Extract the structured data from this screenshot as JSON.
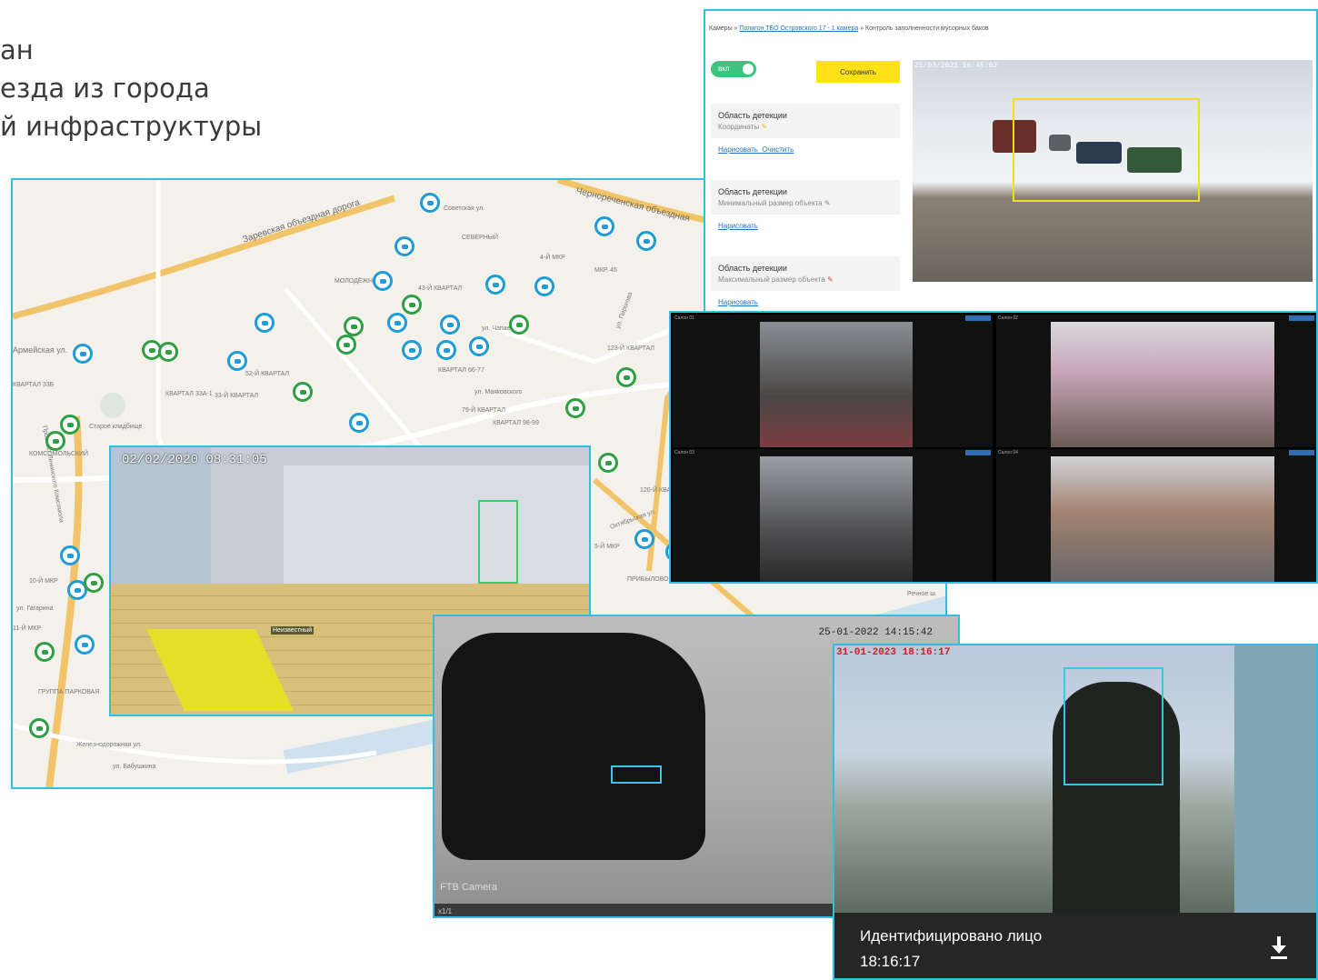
{
  "heading": {
    "line1": "ан",
    "line2": "езда из города",
    "line3": "й инфраструктуры"
  },
  "map": {
    "streets": [
      {
        "text": "Заревская объездная дорога"
      },
      {
        "text": "Черноречeнская объездная"
      },
      {
        "text": "Советская ул."
      },
      {
        "text": "ул. Чапаева"
      },
      {
        "text": "ул. Маяковского"
      },
      {
        "text": "Октябрьская ул."
      },
      {
        "text": "ул. Пирогова"
      },
      {
        "text": "Железнодорожная ул."
      },
      {
        "text": "ул. Бабушкина"
      },
      {
        "text": "Проспект Ленинского Комсомола"
      }
    ],
    "areas": [
      {
        "text": "СЕВЕРНЫЙ"
      },
      {
        "text": "4-Й МКР"
      },
      {
        "text": "МКР. 45"
      },
      {
        "text": "МОЛОДЁЖНЫЙ"
      },
      {
        "text": "43-Й КВАРТАЛ"
      },
      {
        "text": "52-Й КВАРТАЛ"
      },
      {
        "text": "КВАРТАЛ 33А-1"
      },
      {
        "text": "33-Й КВАРТАЛ"
      },
      {
        "text": "КВАРТАЛ 66-77"
      },
      {
        "text": "79-Й КВАРТАЛ"
      },
      {
        "text": "КВАРТАЛ 98-99"
      },
      {
        "text": "123-Й КВАРТАЛ"
      },
      {
        "text": "Старое кладбище"
      },
      {
        "text": "Армейская ул."
      },
      {
        "text": "КВАРТАЛ 33Б"
      },
      {
        "text": "10-Й МКР"
      },
      {
        "text": "11-Й МКР"
      },
      {
        "text": "ГРУППА ПАРКОВАЯ"
      },
      {
        "text": "ПРИБЫЛОВО"
      },
      {
        "text": "120-Й КВАРТАЛ"
      },
      {
        "text": "5-Й МКР"
      },
      {
        "text": "Речное ш."
      },
      {
        "text": "КОМСОМОЛЬСКИЙ"
      },
      {
        "text": "ул. Гагарина"
      }
    ]
  },
  "admin": {
    "breadcrumb_start": "Камеры »",
    "breadcrumb_link": "Полигон ТБО Островского 17 - 1 камера",
    "breadcrumb_end": "» Контроль заполненности мусорных баков",
    "toggle_label": "вкл",
    "save_label": "Сохранить",
    "sections": [
      {
        "title": "Область детекции",
        "subtitle": "Координаты",
        "actions": [
          "Нарисовать",
          "Очистить"
        ]
      },
      {
        "title": "Область детекции",
        "subtitle": "Минимальный размер объекта",
        "actions": [
          "Нарисовать"
        ]
      },
      {
        "title": "Область детекции",
        "subtitle": "Максимальный размер объекта",
        "actions": [
          "Нарисовать"
        ]
      }
    ],
    "camera_timestamp": "25/03/2021 16:45:02"
  },
  "bus": {
    "cells": [
      {
        "title": "Салон 01"
      },
      {
        "title": "Салон 02"
      },
      {
        "title": "Салон 03"
      },
      {
        "title": "Салон 04"
      }
    ]
  },
  "hall": {
    "timestamp": "02/02/2020 08:31:05",
    "tag": "Неизвестный"
  },
  "car": {
    "timestamp": "25-01-2022 14:15:42",
    "brand": "FTB Camera",
    "bar_label": "x1/1"
  },
  "face": {
    "timestamp": "31-01-2023 18:16:17",
    "caption": "Идентифицировано лицо",
    "time": "18:16:17"
  },
  "colors": {
    "frame_border": "#2fc0e0",
    "map_bg": "#f4f1ea",
    "cam_blue": "#1f9bd6",
    "cam_green": "#2f9e44",
    "toggle_green": "#3dc47e",
    "save_yellow": "#ffe11a"
  }
}
